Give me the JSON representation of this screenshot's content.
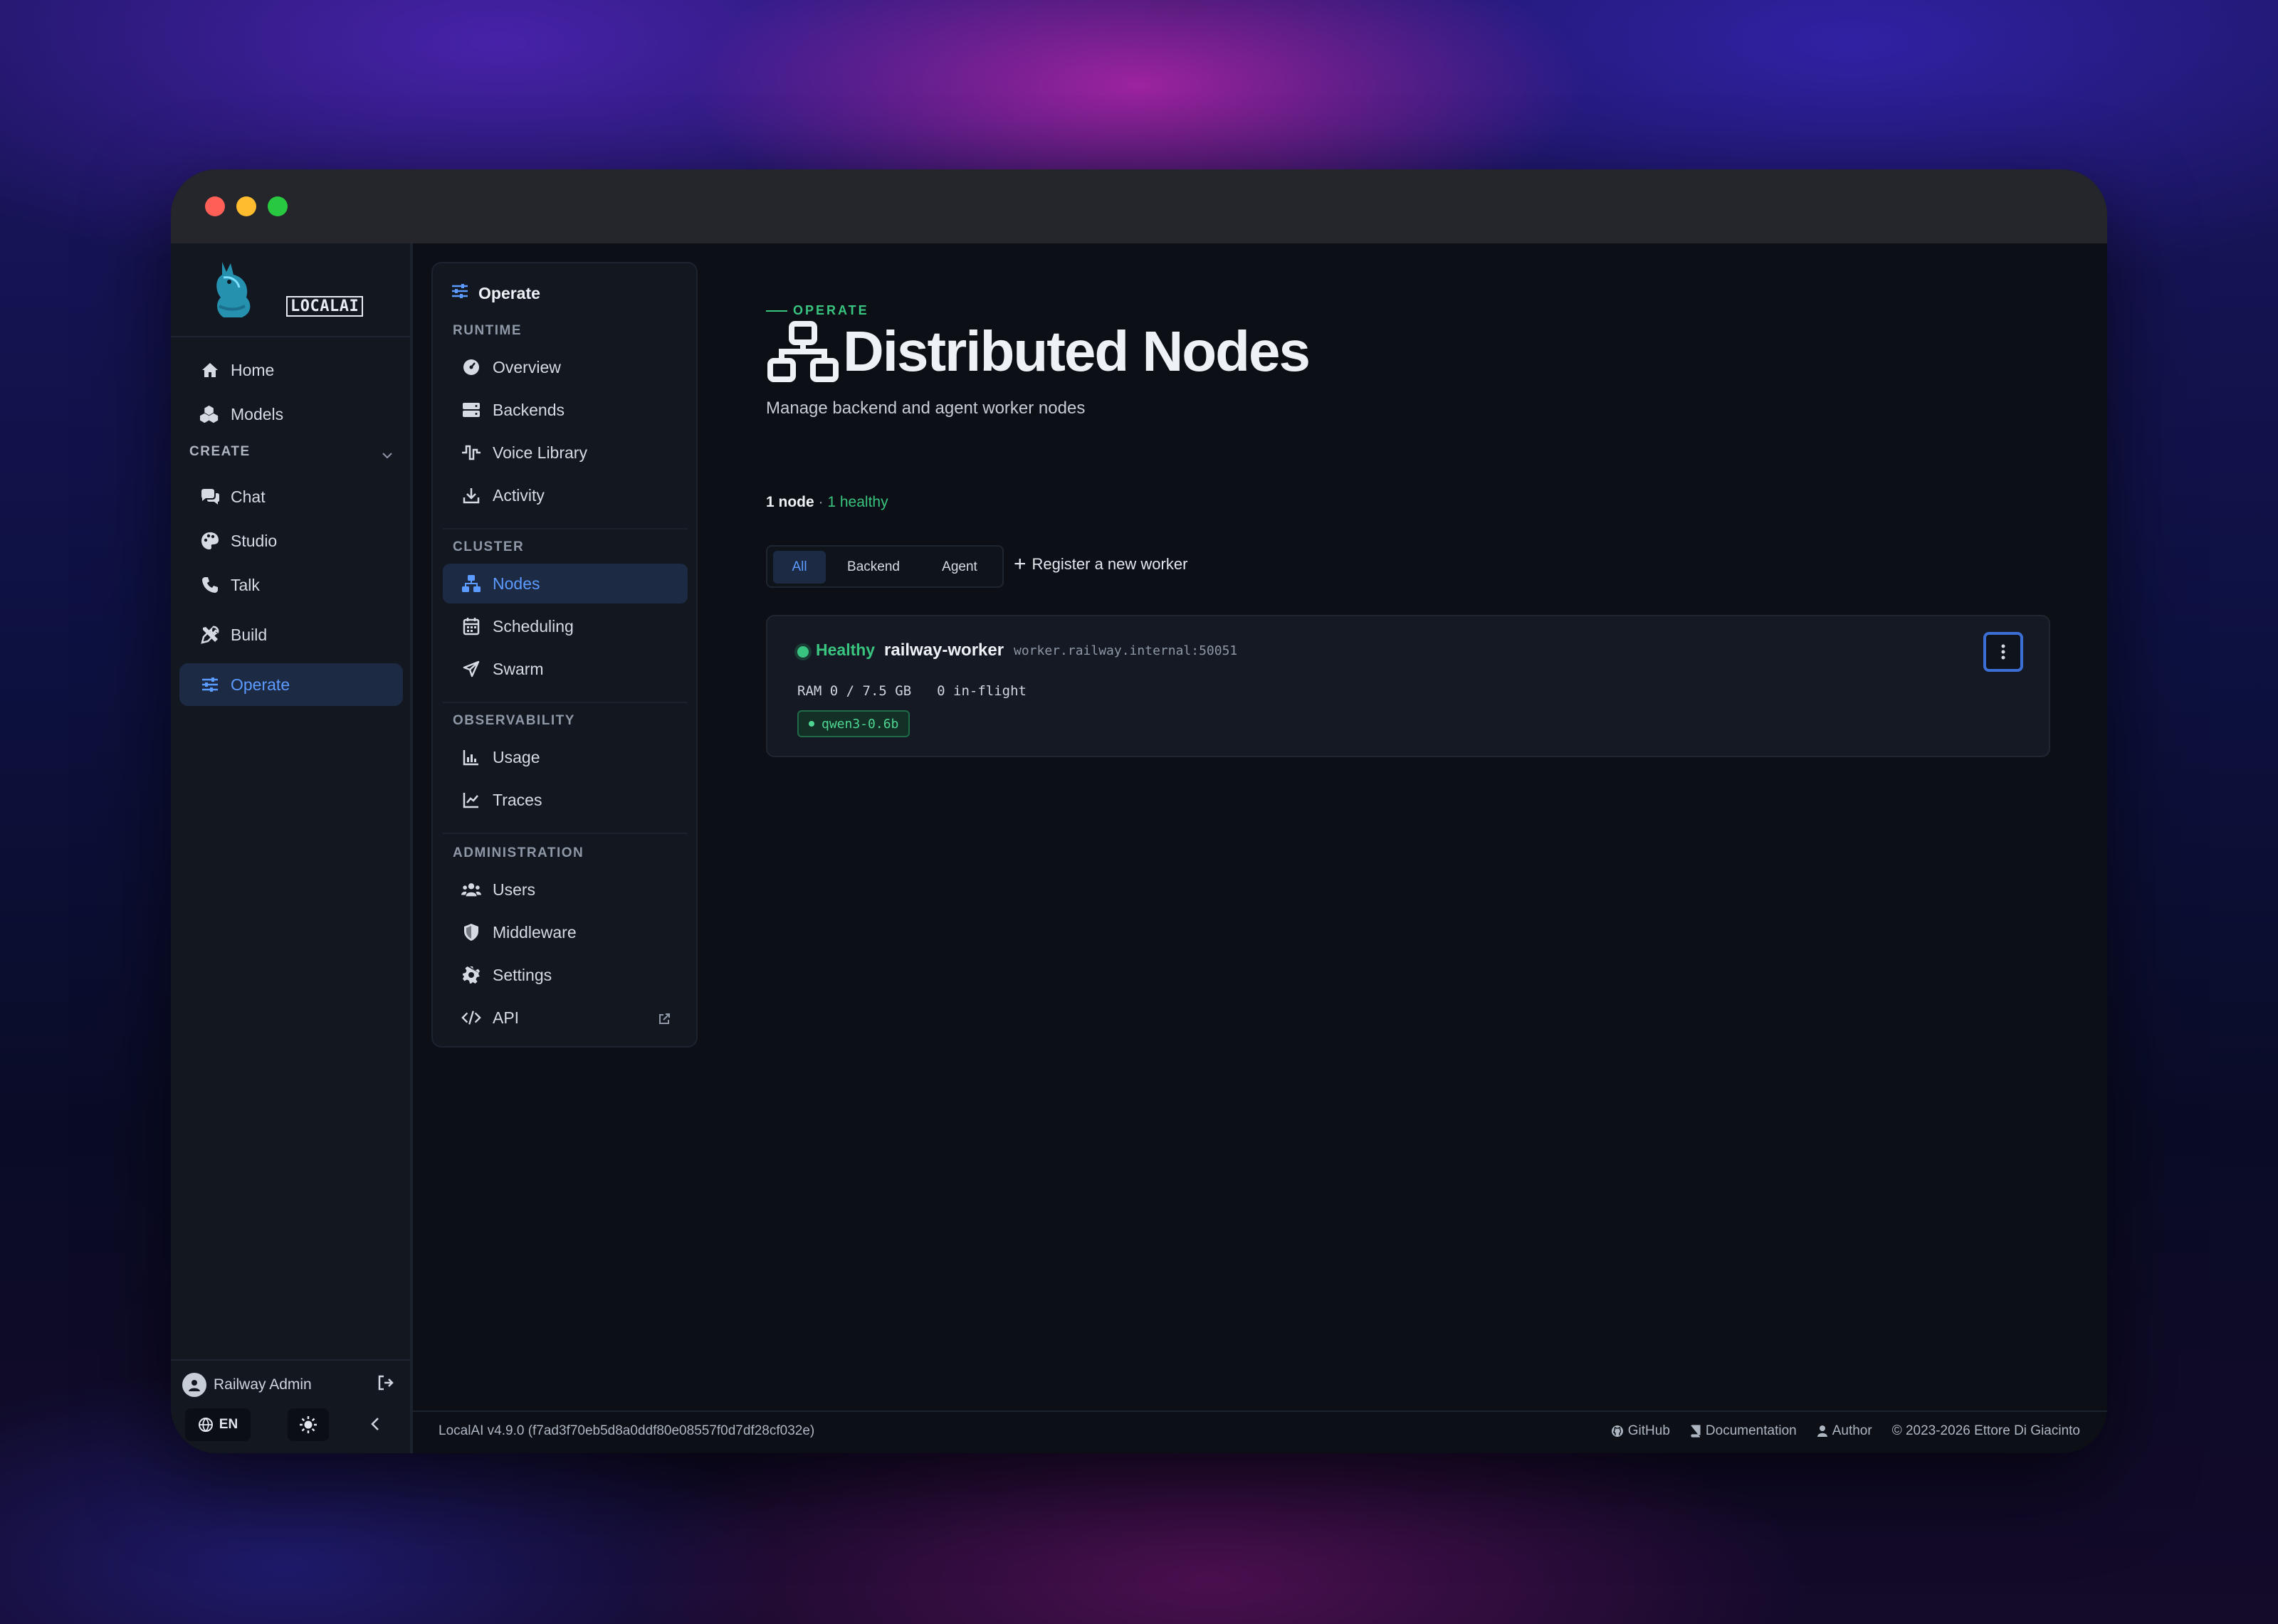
{
  "colors": {
    "accent": "#5c9bff",
    "success": "#39c47f",
    "window_bg": "#0c0f15",
    "panel_bg": "#121720"
  },
  "brand": {
    "logo_text": "LOCALAI"
  },
  "sidebar": {
    "items": [
      {
        "label": "Home",
        "icon": "home-icon"
      },
      {
        "label": "Models",
        "icon": "cubes-icon"
      }
    ],
    "create_section": "CREATE",
    "create_items": [
      {
        "label": "Chat",
        "icon": "chat-icon"
      },
      {
        "label": "Studio",
        "icon": "palette-icon"
      },
      {
        "label": "Talk",
        "icon": "phone-icon"
      }
    ],
    "build_label": "Build",
    "operate_label": "Operate",
    "user_name": "Railway Admin",
    "language": "EN"
  },
  "subnav": {
    "title": "Operate",
    "runtime_section": "RUNTIME",
    "runtime_items": [
      {
        "label": "Overview",
        "icon": "dashboard-icon"
      },
      {
        "label": "Backends",
        "icon": "server-icon"
      },
      {
        "label": "Voice Library",
        "icon": "waveform-icon"
      },
      {
        "label": "Activity",
        "icon": "download-icon"
      }
    ],
    "cluster_section": "CLUSTER",
    "cluster_items": [
      {
        "label": "Nodes",
        "icon": "network-icon"
      },
      {
        "label": "Scheduling",
        "icon": "calendar-icon"
      },
      {
        "label": "Swarm",
        "icon": "send-icon"
      }
    ],
    "observability_section": "OBSERVABILITY",
    "observability_items": [
      {
        "label": "Usage",
        "icon": "bar-chart-icon"
      },
      {
        "label": "Traces",
        "icon": "line-chart-icon"
      }
    ],
    "administration_section": "ADMINISTRATION",
    "administration_items": [
      {
        "label": "Users",
        "icon": "users-icon"
      },
      {
        "label": "Middleware",
        "icon": "shield-icon"
      },
      {
        "label": "Settings",
        "icon": "gear-icon"
      },
      {
        "label": "API",
        "icon": "code-icon"
      }
    ]
  },
  "main": {
    "kicker": "OPERATE",
    "title": "Distributed Nodes",
    "subtitle": "Manage backend and agent worker nodes",
    "count_nodes": "1 node",
    "count_sep": " · ",
    "count_healthy": "1 healthy",
    "filters": [
      "All",
      "Backend",
      "Agent"
    ],
    "register_label": "Register a new worker"
  },
  "node": {
    "status": "Healthy",
    "name": "railway-worker",
    "address": "worker.railway.internal:50051",
    "ram": "RAM 0 / 7.5 GB",
    "inflight": "0 in-flight",
    "model": "qwen3-0.6b"
  },
  "footer": {
    "version": "LocalAI v4.9.0 (f7ad3f70eb5d8a0ddf80e08557f0d7df28cf032e)",
    "github": "GitHub",
    "documentation": "Documentation",
    "author": "Author",
    "copyright": "© 2023-2026 Ettore Di Giacinto"
  }
}
